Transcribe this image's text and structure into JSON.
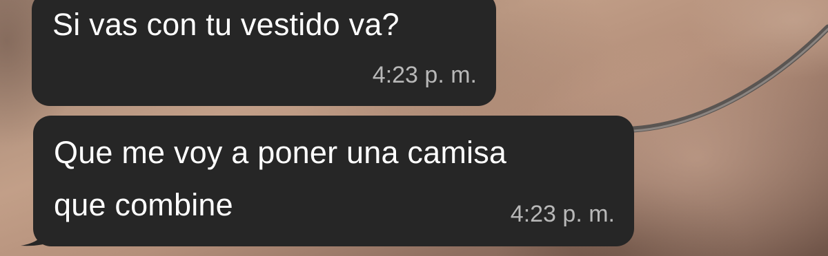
{
  "chat": {
    "messages": [
      {
        "text": "Si vas con tu vestido va?",
        "time": "4:23 p. m."
      },
      {
        "line1": "Que me voy a poner una camisa",
        "line2": "que combine",
        "time": "4:23 p. m."
      }
    ]
  },
  "colors": {
    "bubble": "#262626",
    "text": "#ffffff",
    "timestamp": "#b8b8b8"
  }
}
